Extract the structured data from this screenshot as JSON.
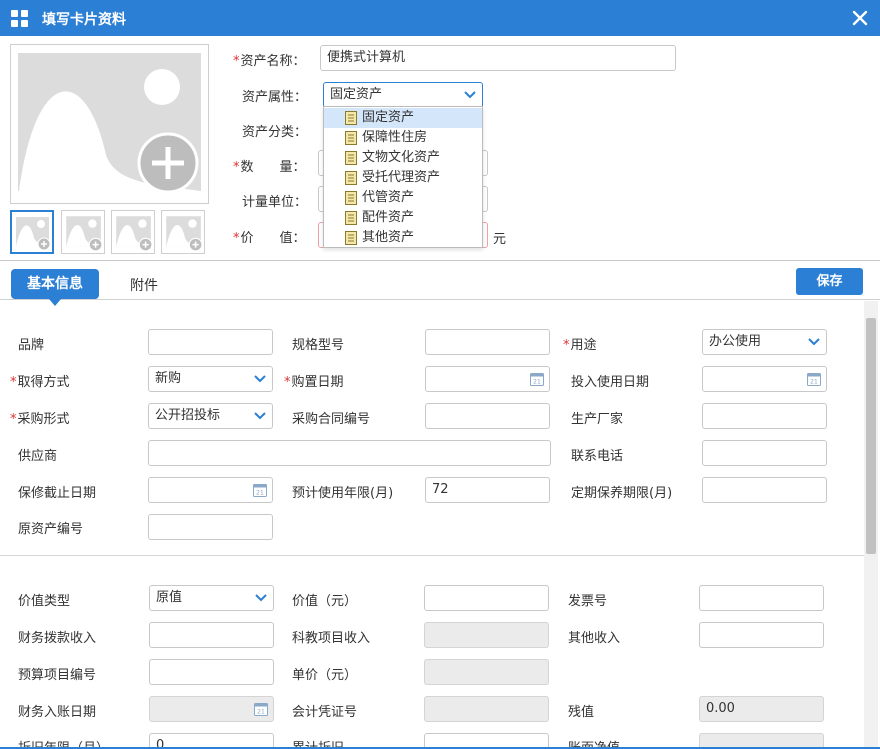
{
  "window": {
    "title": "填写卡片资料",
    "accent_color": "#2b7fd4",
    "app_icon": "grid-icon",
    "close_icon": "close-icon"
  },
  "header_form": {
    "asset_name_label": "资产名称：",
    "asset_name_value": "便携式计算机",
    "attribute_label": "资产属性：",
    "attribute_value": "固定资产",
    "category_label": "资产分类：",
    "quantity_label": "数　　量：",
    "unit_label": "计量单位：",
    "value_label": "价　　值：",
    "value_unit": "元"
  },
  "attribute_dropdown": {
    "items": [
      "固定资产",
      "保障性住房",
      "文物文化资产",
      "受托代理资产",
      "代管资产",
      "配件资产",
      "其他资产"
    ],
    "highlighted": "固定资产"
  },
  "tabs": {
    "basic": "基本信息",
    "attachment": "附件"
  },
  "save_label": "保存",
  "basic": {
    "brand_label": "品牌",
    "model_label": "规格型号",
    "usage_label": "用途",
    "usage_value": "办公使用",
    "acquire_label": "取得方式",
    "acquire_value": "新购",
    "purchase_date_label": "购置日期",
    "inuse_date_label": "投入使用日期",
    "purchase_form_label": "采购形式",
    "purchase_form_value": "公开招投标",
    "contract_no_label": "采购合同编号",
    "manufacturer_label": "生产厂家",
    "supplier_label": "供应商",
    "phone_label": "联系电话",
    "warranty_label": "保修截止日期",
    "life_label": "预计使用年限(月)",
    "life_value": "72",
    "maintenance_label": "定期保养期限(月)",
    "orig_no_label": "原资产编号"
  },
  "finance": {
    "value_type_label": "价值类型",
    "value_type_value": "原值",
    "value_label": "价值（元）",
    "invoice_label": "发票号",
    "fiscal_income_label": "财务拨款收入",
    "research_income_label": "科教项目收入",
    "other_income_label": "其他收入",
    "budget_no_label": "预算项目编号",
    "unit_price_label": "单价（元）",
    "entry_date_label": "财务入账日期",
    "voucher_label": "会计凭证号",
    "residual_label": "残值",
    "residual_value": "0.00",
    "depr_years_label": "折旧年限（月）",
    "depr_years_value": "0",
    "accum_depr_label": "累计折旧",
    "net_value_label": "账面净值"
  }
}
